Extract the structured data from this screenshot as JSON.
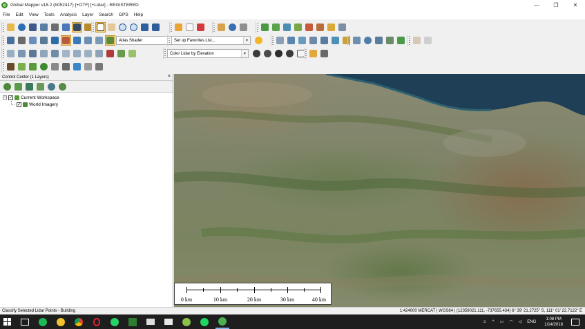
{
  "window": {
    "title": "Global Mapper v18.2 (b052417) [+OTF] [+Lidar] - REGISTERED",
    "minimize": "—",
    "maximize": "❐",
    "close": "✕"
  },
  "menu": [
    "File",
    "Edit",
    "View",
    "Tools",
    "Analysis",
    "Layer",
    "Search",
    "GPS",
    "Help"
  ],
  "toolbars": {
    "shader_select": "Atlas Shader",
    "favorites_select": "Set up Favorites List...",
    "lidar_color_select": "Color Lidar by Elevation"
  },
  "control_center": {
    "title": "Control Center (1 Layers)",
    "close": "×",
    "workspace_label": "Current Workspace",
    "layers": [
      {
        "name": "World Imagery",
        "checked": true
      }
    ],
    "expander": "−",
    "check_mark": "✓"
  },
  "scalebar": {
    "labels": [
      "0 km",
      "10 km",
      "20 km",
      "30 km",
      "40 km"
    ]
  },
  "status": {
    "left": "Classify Selected Lidar Points - Building",
    "right": "1:424000  MERCAT | WGS84 | (12359021.111, -737655.434)  6° 39' 21.2725\" S, 111° 01' 22.7122\" E"
  },
  "taskbar": {
    "language": "ENG",
    "time": "1:08 PM",
    "date": "1/14/2018"
  },
  "colors": {
    "accent_active": "#f6d27a",
    "taskbar": "#1e1e1e",
    "sea": "#1f3f56"
  }
}
